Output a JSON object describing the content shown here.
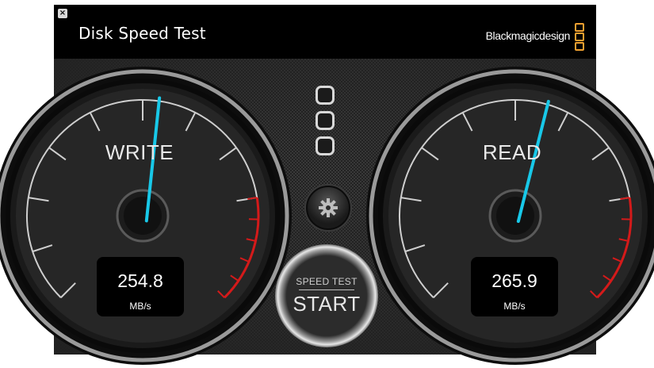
{
  "window": {
    "title": "Disk Speed Test",
    "brand": "Blackmagicdesign",
    "close_icon": "close-icon"
  },
  "gauges": {
    "write": {
      "label": "WRITE",
      "value": "254.8",
      "unit": "MB/s",
      "needle_fraction": 0.53
    },
    "read": {
      "label": "READ",
      "value": "265.9",
      "unit": "MB/s",
      "needle_fraction": 0.56
    }
  },
  "controls": {
    "settings_icon": "gear-icon",
    "start_top": "SPEED TEST",
    "start_main": "START"
  },
  "colors": {
    "needle": "#18c8e8",
    "redline": "#d41a1a",
    "brand_accent": "#f0a030"
  }
}
